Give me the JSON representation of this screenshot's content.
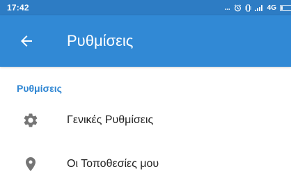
{
  "status_bar": {
    "time": "17:42",
    "dots": "...",
    "network": "4G",
    "battery_level": 0.15
  },
  "toolbar": {
    "title": "Ρυθμίσεις",
    "back_icon": "arrow-left-icon"
  },
  "settings": {
    "section_header": "Ρυθμίσεις",
    "items": [
      {
        "label": "Γενικές Ρυθμίσεις",
        "icon": "gear-icon"
      },
      {
        "label": "Οι Τοποθεσίες μου",
        "icon": "location-pin-icon"
      }
    ]
  },
  "colors": {
    "status_bar": "#2d7cc4",
    "toolbar": "#3189d5",
    "accent": "#2f86d3",
    "icon": "#757575",
    "text": "#212121"
  }
}
